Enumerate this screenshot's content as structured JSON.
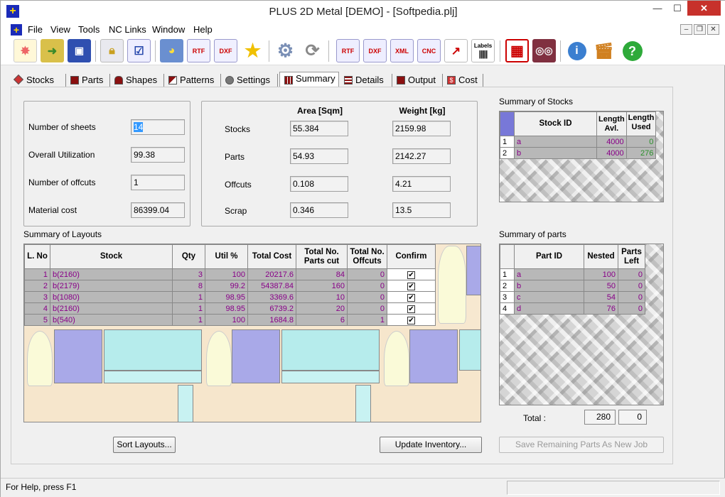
{
  "window": {
    "title": "PLUS 2D Metal [DEMO] - [Softpedia.plj]",
    "minimize": "—",
    "maximize": "☐",
    "close": "✕"
  },
  "menu": [
    "File",
    "View",
    "Tools",
    "NC Links",
    "Window",
    "Help"
  ],
  "mdi": {
    "minimize": "–",
    "restore": "❐",
    "close": "✕"
  },
  "toolbar": {
    "rtf": "RTF",
    "dxf": "DXF",
    "xml": "XML",
    "cnc": "CNC",
    "labels": "Labels"
  },
  "tabs": [
    "Stocks",
    "Parts",
    "Shapes",
    "Patterns",
    "Settings",
    "Summary",
    "Details",
    "Output",
    "Cost"
  ],
  "active_tab": "Summary",
  "summary": {
    "sheets_label": "Number of sheets",
    "sheets_value": "14",
    "util_label": "Overall Utilization",
    "util_value": "99.38",
    "offcuts_label": "Number of offcuts",
    "offcuts_value": "1",
    "cost_label": "Material cost",
    "cost_value": "86399.04"
  },
  "area_weight": {
    "area_header": "Area [Sqm]",
    "weight_header": "Weight [kg]",
    "rows": [
      {
        "label": "Stocks",
        "area": "55.384",
        "weight": "2159.98"
      },
      {
        "label": "Parts",
        "area": "54.93",
        "weight": "2142.27"
      },
      {
        "label": "Offcuts",
        "area": "0.108",
        "weight": "4.21"
      },
      {
        "label": "Scrap",
        "area": "0.346",
        "weight": "13.5"
      }
    ]
  },
  "layouts": {
    "title": "Summary of Layouts",
    "headers": [
      "L. No",
      "Stock",
      "Qty",
      "Util %",
      "Total Cost",
      "Total No. Parts cut",
      "Total No. Offcuts",
      "Confirm"
    ],
    "rows": [
      {
        "no": "1",
        "stock": "b(2160)",
        "qty": "3",
        "util": "100",
        "cost": "20217.6",
        "parts": "84",
        "offcuts": "0",
        "confirm": "✔"
      },
      {
        "no": "2",
        "stock": "b(2179)",
        "qty": "8",
        "util": "99.2",
        "cost": "54387.84",
        "parts": "160",
        "offcuts": "0",
        "confirm": "✔"
      },
      {
        "no": "3",
        "stock": "b(1080)",
        "qty": "1",
        "util": "98.95",
        "cost": "3369.6",
        "parts": "10",
        "offcuts": "0",
        "confirm": "✔"
      },
      {
        "no": "4",
        "stock": "b(2160)",
        "qty": "1",
        "util": "98.95",
        "cost": "6739.2",
        "parts": "20",
        "offcuts": "0",
        "confirm": "✔"
      },
      {
        "no": "5",
        "stock": "b(540)",
        "qty": "1",
        "util": "100",
        "cost": "1684.8",
        "parts": "6",
        "offcuts": "1",
        "confirm": "✔"
      }
    ]
  },
  "stocks_summary": {
    "title": "Summary of Stocks",
    "headers": [
      "Stock ID",
      "Length Avl.",
      "Length Used"
    ],
    "rows": [
      {
        "n": "1",
        "id": "a",
        "avl": "4000",
        "used": "0"
      },
      {
        "n": "2",
        "id": "b",
        "avl": "4000",
        "used": "276"
      }
    ]
  },
  "parts_summary": {
    "title": "Summary of parts",
    "headers": [
      "Part ID",
      "Nested",
      "Parts Left"
    ],
    "rows": [
      {
        "n": "1",
        "id": "a",
        "nested": "100",
        "left": "0"
      },
      {
        "n": "2",
        "id": "b",
        "nested": "50",
        "left": "0"
      },
      {
        "n": "3",
        "id": "c",
        "nested": "54",
        "left": "0"
      },
      {
        "n": "4",
        "id": "d",
        "nested": "76",
        "left": "0"
      }
    ],
    "total_label": "Total :",
    "total_nested": "280",
    "total_left": "0"
  },
  "buttons": {
    "sort": "Sort Layouts...",
    "update": "Update Inventory...",
    "save": "Save Remaining Parts As New Job"
  },
  "status": "For Help, press F1",
  "colors": {
    "accent": "#1b2bb8",
    "row_selected": "#b8b8b8",
    "purple_text": "#880088",
    "green_text": "#2a8f2a"
  }
}
